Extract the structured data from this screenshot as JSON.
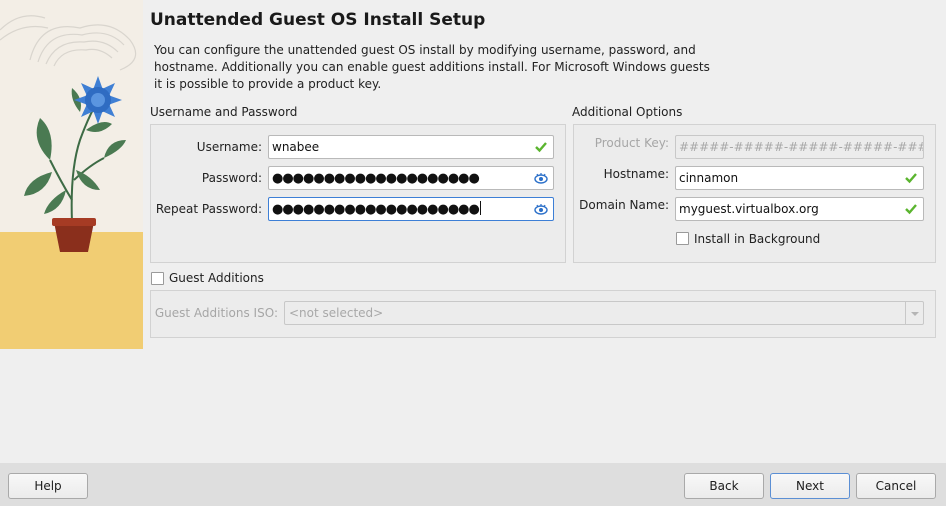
{
  "page": {
    "title": "Unattended Guest OS Install Setup",
    "description": "You can configure the unattended guest OS install by modifying username, password, and hostname. Additionally you can enable guest additions install. For Microsoft Windows guests it is possible to provide a product key."
  },
  "credentials": {
    "group_label": "Username and Password",
    "username_label": "Username:",
    "username_value": "wnabee",
    "password_label": "Password:",
    "password_value": "●●●●●●●●●●●●●●●●●●●●",
    "repeat_password_label": "Repeat Password:",
    "repeat_password_value": "●●●●●●●●●●●●●●●●●●●●"
  },
  "additional_options": {
    "group_label": "Additional Options",
    "product_key_label": "Product Key:",
    "product_key_placeholder": "#####-#####-#####-#####-#####",
    "hostname_label": "Hostname:",
    "hostname_value": "cinnamon",
    "domain_label": "Domain Name:",
    "domain_value": "myguest.virtualbox.org",
    "install_background_label": "Install in Background",
    "install_background_checked": false
  },
  "guest_additions": {
    "label": "Guest Additions",
    "checked": false,
    "iso_label": "Guest Additions ISO:",
    "iso_value": "<not selected>"
  },
  "footer": {
    "help_label": "Help",
    "back_label": "Back",
    "next_label": "Next",
    "cancel_label": "Cancel"
  },
  "colors": {
    "valid_check": "#5bb52f",
    "focus_border": "#3d7fd6",
    "eye_icon": "#2a6fc9"
  }
}
